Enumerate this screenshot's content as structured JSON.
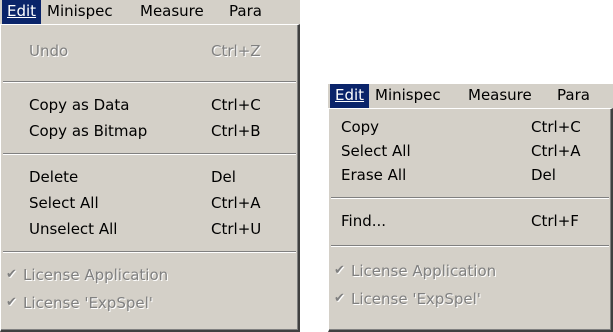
{
  "left_menu": {
    "menubar": [
      {
        "label": "Edit",
        "mnemonic": "E",
        "active": true
      },
      {
        "label": "Minispec",
        "mnemonic": "M"
      },
      {
        "label": "Measure",
        "mnemonic": "M"
      },
      {
        "label": "Para",
        "mnemonic": "P"
      }
    ],
    "items": {
      "undo": {
        "label": "Undo",
        "shortcut": "Ctrl+Z"
      },
      "copy_as_data": {
        "label": "Copy as Data",
        "shortcut": "Ctrl+C"
      },
      "copy_as_bitmap": {
        "label": "Copy as Bitmap",
        "shortcut": "Ctrl+B"
      },
      "delete": {
        "label": "Delete",
        "shortcut": "Del"
      },
      "select_all": {
        "label": "Select All",
        "shortcut": "Ctrl+A"
      },
      "unselect_all": {
        "label": "Unselect All",
        "shortcut": "Ctrl+U"
      },
      "license_application": {
        "label": "License Application"
      },
      "license_expspel": {
        "label": "License 'ExpSpel'"
      }
    }
  },
  "right_menu": {
    "menubar": [
      {
        "label": "Edit",
        "mnemonic": "E",
        "active": true
      },
      {
        "label": "Minispec",
        "mnemonic": "M"
      },
      {
        "label": "Measure",
        "mnemonic": "M"
      },
      {
        "label": "Para",
        "mnemonic": "P"
      }
    ],
    "items": {
      "copy": {
        "label": "Copy",
        "shortcut": "Ctrl+C"
      },
      "select_all": {
        "label": "Select All",
        "shortcut": "Ctrl+A"
      },
      "erase_all": {
        "label": "Erase All",
        "shortcut": "Del"
      },
      "find": {
        "label": "Find...",
        "shortcut": "Ctrl+F"
      },
      "license_application": {
        "label": "License Application"
      },
      "license_expspel": {
        "label": "License 'ExpSpel'"
      }
    }
  },
  "icons": {
    "checkmark": "✔"
  },
  "colors": {
    "menu_face": "#d4d0c8",
    "highlight": "#0a246a",
    "disabled_text": "#808080"
  }
}
